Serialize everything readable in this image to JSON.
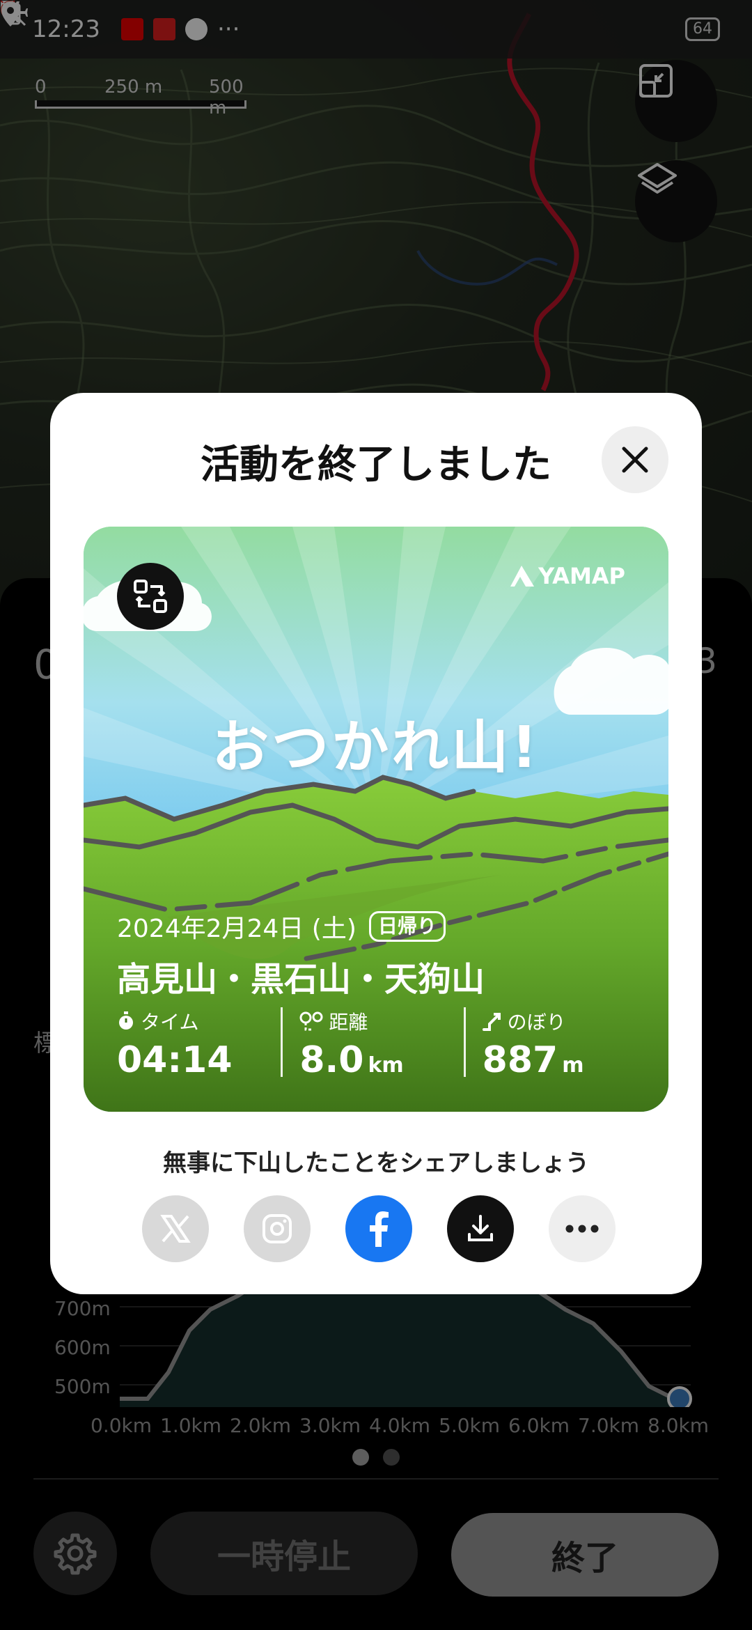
{
  "status_bar": {
    "time": "12:23",
    "more": "···",
    "battery": "64"
  },
  "map": {
    "scale_labels": [
      "0",
      "250 m",
      "500 m"
    ],
    "route_color": "#c0152a"
  },
  "panel": {
    "peek_left": "0",
    "peek_right": "3",
    "section_label": "標",
    "elevation_y_labels": [
      "700m",
      "600m",
      "500m"
    ],
    "elevation_x_labels": [
      "0.0km",
      "1.0km",
      "2.0km",
      "3.0km",
      "4.0km",
      "5.0km",
      "6.0km",
      "7.0km",
      "8.0km"
    ],
    "pause_label": "一時停止",
    "end_label": "終了"
  },
  "modal": {
    "title": "活動を終了しました",
    "card": {
      "brand": "YAMAP",
      "slogan": "おつかれ山!",
      "date": "2024年2月24日 (土)",
      "trip_type": "日帰り",
      "mountains": "高見山・黒石山・天狗山",
      "stats": [
        {
          "label": "タイム",
          "value": "04:14",
          "unit": ""
        },
        {
          "label": "距離",
          "value": "8.0",
          "unit": "km"
        },
        {
          "label": "のぼり",
          "value": "887",
          "unit": "m"
        }
      ]
    },
    "share_text": "無事に下山したことをシェアしましょう",
    "share_buttons": [
      "x",
      "instagram",
      "facebook",
      "download",
      "more"
    ],
    "colors": {
      "facebook": "#1877f2",
      "disabled": "#d9d9d9"
    }
  }
}
